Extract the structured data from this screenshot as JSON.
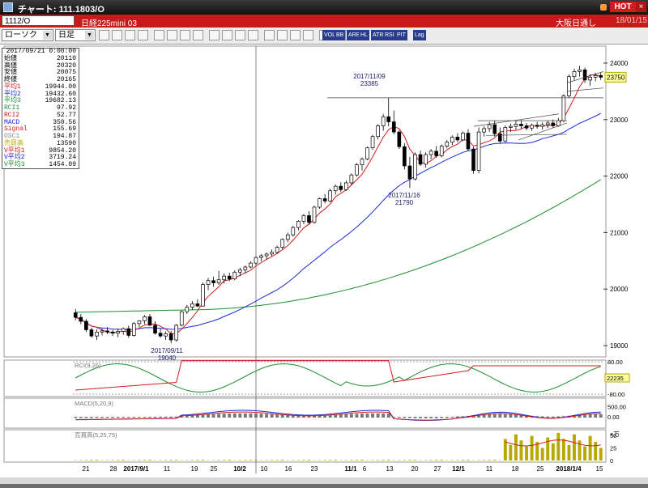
{
  "window": {
    "title": "チャート: 111.1803/O",
    "hot_label": "HOT",
    "close_label": "×"
  },
  "symbol_bar": {
    "code": "1112/O",
    "name": "日経225mini 03",
    "exchange": "大阪日通し",
    "date": "18/01/15"
  },
  "toolbar": {
    "chart_type": "ローソク",
    "period": "日足",
    "text_buttons": [
      "VOL",
      "BB",
      "ARE",
      "HL",
      "ATR",
      "RSI",
      "PIT",
      "Lag"
    ]
  },
  "info_panel": {
    "datetime": "2017/09/21 0:00:00",
    "rows": [
      {
        "k": "始値",
        "v": "20110",
        "c": "#000000"
      },
      {
        "k": "高値",
        "v": "20320",
        "c": "#000000"
      },
      {
        "k": "安値",
        "v": "20075",
        "c": "#000000"
      },
      {
        "k": "終値",
        "v": "20165",
        "c": "#000000"
      },
      {
        "k": "平均1",
        "v": "19944.00",
        "c": "#d21b1b"
      },
      {
        "k": "平均2",
        "v": "19432.60",
        "c": "#1c2bd6"
      },
      {
        "k": "平均3",
        "v": "19682.13",
        "c": "#1b8f2b"
      },
      {
        "k": "RCI1",
        "v": "97.92",
        "c": "#1b8f2b"
      },
      {
        "k": "RCI2",
        "v": "52.77",
        "c": "#d21b1b"
      },
      {
        "k": "MACD",
        "v": "350.56",
        "c": "#1c2bd6"
      },
      {
        "k": "Signal",
        "v": "155.69",
        "c": "#d21b1b"
      },
      {
        "k": "OSC1",
        "v": "194.87",
        "c": "#888888"
      },
      {
        "k": "売買高",
        "v": "13590",
        "c": "#b8a800"
      },
      {
        "k": "V平均1",
        "v": "9854.20",
        "c": "#d21b1b"
      },
      {
        "k": "V平均2",
        "v": "3719.24",
        "c": "#1c2bd6"
      },
      {
        "k": "V平均3",
        "v": "1454.09",
        "c": "#1b8f2b"
      }
    ]
  },
  "price_axis": {
    "ticks": [
      "24000",
      "23000",
      "22000",
      "21000",
      "20000",
      "19000"
    ],
    "current": "23750"
  },
  "annotations": [
    {
      "date": "2017/11/09",
      "value": "23385"
    },
    {
      "date": "2017/11/16",
      "value": "21790"
    },
    {
      "date": "2017/09/11",
      "value": "19040"
    }
  ],
  "rci_panel": {
    "label": "RCI(9,26)",
    "ticks": [
      "80.00",
      "-80.00"
    ],
    "current": "22235"
  },
  "macd_panel": {
    "label": "MACD(5,20,9)",
    "ticks": [
      "500.00",
      "0.00"
    ]
  },
  "volume_panel": {
    "label": "売買高(5,25,75)",
    "ticks": [
      "50",
      "25",
      "0"
    ],
    "unit": "×万"
  },
  "x_axis": {
    "labels": [
      "21",
      "28",
      "2017/9/1",
      "11",
      "19",
      "25",
      "10/2",
      "10",
      "16",
      "23",
      "11/1",
      "6",
      "13",
      "20",
      "27",
      "12/1",
      "11",
      "18",
      "25",
      "2018/1/4",
      "15"
    ]
  },
  "chart_data": {
    "type": "candlestick",
    "y_range": [
      18800,
      24300
    ],
    "candles": [
      {
        "o": 19580,
        "h": 19650,
        "l": 19450,
        "c": 19500
      },
      {
        "o": 19500,
        "h": 19560,
        "l": 19380,
        "c": 19430
      },
      {
        "o": 19430,
        "h": 19470,
        "l": 19240,
        "c": 19280
      },
      {
        "o": 19280,
        "h": 19320,
        "l": 19140,
        "c": 19170
      },
      {
        "o": 19170,
        "h": 19290,
        "l": 19100,
        "c": 19240
      },
      {
        "o": 19240,
        "h": 19300,
        "l": 19180,
        "c": 19260
      },
      {
        "o": 19260,
        "h": 19330,
        "l": 19200,
        "c": 19240
      },
      {
        "o": 19240,
        "h": 19280,
        "l": 19170,
        "c": 19220
      },
      {
        "o": 19220,
        "h": 19300,
        "l": 19150,
        "c": 19250
      },
      {
        "o": 19250,
        "h": 19320,
        "l": 19190,
        "c": 19300
      },
      {
        "o": 19300,
        "h": 19350,
        "l": 19140,
        "c": 19180
      },
      {
        "o": 19180,
        "h": 19420,
        "l": 19160,
        "c": 19390
      },
      {
        "o": 19390,
        "h": 19450,
        "l": 19330,
        "c": 19440
      },
      {
        "o": 19440,
        "h": 19540,
        "l": 19380,
        "c": 19510
      },
      {
        "o": 19510,
        "h": 19560,
        "l": 19350,
        "c": 19360
      },
      {
        "o": 19360,
        "h": 19430,
        "l": 19190,
        "c": 19220
      },
      {
        "o": 19220,
        "h": 19300,
        "l": 19140,
        "c": 19170
      },
      {
        "o": 19170,
        "h": 19250,
        "l": 19100,
        "c": 19210
      },
      {
        "o": 19210,
        "h": 19260,
        "l": 19040,
        "c": 19100
      },
      {
        "o": 19100,
        "h": 19380,
        "l": 19070,
        "c": 19360
      },
      {
        "o": 19360,
        "h": 19620,
        "l": 19340,
        "c": 19600
      },
      {
        "o": 19600,
        "h": 19720,
        "l": 19560,
        "c": 19680
      },
      {
        "o": 19680,
        "h": 19790,
        "l": 19630,
        "c": 19740
      },
      {
        "o": 19740,
        "h": 19820,
        "l": 19680,
        "c": 19700
      },
      {
        "o": 19700,
        "h": 20120,
        "l": 19690,
        "c": 20080
      },
      {
        "o": 20080,
        "h": 20200,
        "l": 19980,
        "c": 20150
      },
      {
        "o": 20150,
        "h": 20220,
        "l": 20040,
        "c": 20110
      },
      {
        "o": 20110,
        "h": 20320,
        "l": 20075,
        "c": 20165
      },
      {
        "o": 20165,
        "h": 20280,
        "l": 20100,
        "c": 20230
      },
      {
        "o": 20230,
        "h": 20290,
        "l": 20140,
        "c": 20180
      },
      {
        "o": 20180,
        "h": 20330,
        "l": 20160,
        "c": 20300
      },
      {
        "o": 20300,
        "h": 20380,
        "l": 20230,
        "c": 20340
      },
      {
        "o": 20340,
        "h": 20420,
        "l": 20280,
        "c": 20390
      },
      {
        "o": 20390,
        "h": 20490,
        "l": 20370,
        "c": 20460
      },
      {
        "o": 20460,
        "h": 20580,
        "l": 20430,
        "c": 20560
      },
      {
        "o": 20560,
        "h": 20620,
        "l": 20490,
        "c": 20590
      },
      {
        "o": 20590,
        "h": 20650,
        "l": 20520,
        "c": 20620
      },
      {
        "o": 20620,
        "h": 20700,
        "l": 20580,
        "c": 20650
      },
      {
        "o": 20650,
        "h": 20770,
        "l": 20620,
        "c": 20740
      },
      {
        "o": 20740,
        "h": 20900,
        "l": 20700,
        "c": 20880
      },
      {
        "o": 20880,
        "h": 21000,
        "l": 20830,
        "c": 20960
      },
      {
        "o": 20960,
        "h": 21120,
        "l": 20930,
        "c": 21090
      },
      {
        "o": 21090,
        "h": 21220,
        "l": 21040,
        "c": 21200
      },
      {
        "o": 21200,
        "h": 21330,
        "l": 21150,
        "c": 21300
      },
      {
        "o": 21300,
        "h": 21380,
        "l": 21140,
        "c": 21180
      },
      {
        "o": 21180,
        "h": 21480,
        "l": 21160,
        "c": 21450
      },
      {
        "o": 21450,
        "h": 21620,
        "l": 21420,
        "c": 21600
      },
      {
        "o": 21600,
        "h": 21680,
        "l": 21520,
        "c": 21560
      },
      {
        "o": 21560,
        "h": 21780,
        "l": 21540,
        "c": 21740
      },
      {
        "o": 21740,
        "h": 21850,
        "l": 21670,
        "c": 21820
      },
      {
        "o": 21820,
        "h": 21890,
        "l": 21720,
        "c": 21760
      },
      {
        "o": 21760,
        "h": 21920,
        "l": 21740,
        "c": 21880
      },
      {
        "o": 21880,
        "h": 22050,
        "l": 21840,
        "c": 22020
      },
      {
        "o": 22020,
        "h": 22230,
        "l": 21990,
        "c": 22200
      },
      {
        "o": 22200,
        "h": 22330,
        "l": 22100,
        "c": 22300
      },
      {
        "o": 22300,
        "h": 22520,
        "l": 22280,
        "c": 22500
      },
      {
        "o": 22500,
        "h": 22730,
        "l": 22460,
        "c": 22700
      },
      {
        "o": 22700,
        "h": 22920,
        "l": 22650,
        "c": 22890
      },
      {
        "o": 22890,
        "h": 23100,
        "l": 22800,
        "c": 23050
      },
      {
        "o": 23050,
        "h": 23385,
        "l": 22880,
        "c": 22960
      },
      {
        "o": 22960,
        "h": 23160,
        "l": 22740,
        "c": 22780
      },
      {
        "o": 22780,
        "h": 22820,
        "l": 22480,
        "c": 22520
      },
      {
        "o": 22520,
        "h": 22580,
        "l": 22120,
        "c": 22180
      },
      {
        "o": 22180,
        "h": 22340,
        "l": 21790,
        "c": 21950
      },
      {
        "o": 21950,
        "h": 22420,
        "l": 21920,
        "c": 22380
      },
      {
        "o": 22380,
        "h": 22450,
        "l": 22180,
        "c": 22210
      },
      {
        "o": 22210,
        "h": 22420,
        "l": 22150,
        "c": 22380
      },
      {
        "o": 22380,
        "h": 22480,
        "l": 22300,
        "c": 22440
      },
      {
        "o": 22440,
        "h": 22530,
        "l": 22320,
        "c": 22360
      },
      {
        "o": 22360,
        "h": 22560,
        "l": 22330,
        "c": 22530
      },
      {
        "o": 22530,
        "h": 22640,
        "l": 22490,
        "c": 22600
      },
      {
        "o": 22600,
        "h": 22720,
        "l": 22550,
        "c": 22690
      },
      {
        "o": 22690,
        "h": 22760,
        "l": 22600,
        "c": 22640
      },
      {
        "o": 22640,
        "h": 22790,
        "l": 22620,
        "c": 22760
      },
      {
        "o": 22760,
        "h": 22830,
        "l": 22450,
        "c": 22480
      },
      {
        "o": 22480,
        "h": 22520,
        "l": 22040,
        "c": 22100
      },
      {
        "o": 22100,
        "h": 22860,
        "l": 22050,
        "c": 22780
      },
      {
        "o": 22780,
        "h": 22880,
        "l": 22700,
        "c": 22840
      },
      {
        "o": 22840,
        "h": 22960,
        "l": 22780,
        "c": 22910
      },
      {
        "o": 22910,
        "h": 22980,
        "l": 22700,
        "c": 22750
      },
      {
        "o": 22750,
        "h": 22860,
        "l": 22580,
        "c": 22620
      },
      {
        "o": 22620,
        "h": 22900,
        "l": 22600,
        "c": 22860
      },
      {
        "o": 22860,
        "h": 22930,
        "l": 22780,
        "c": 22880
      },
      {
        "o": 22880,
        "h": 22990,
        "l": 22820,
        "c": 22920
      },
      {
        "o": 22920,
        "h": 23000,
        "l": 22840,
        "c": 22890
      },
      {
        "o": 22890,
        "h": 22940,
        "l": 22810,
        "c": 22850
      },
      {
        "o": 22850,
        "h": 22930,
        "l": 22800,
        "c": 22900
      },
      {
        "o": 22900,
        "h": 22960,
        "l": 22840,
        "c": 22880
      },
      {
        "o": 22880,
        "h": 22950,
        "l": 22820,
        "c": 22910
      },
      {
        "o": 22910,
        "h": 22980,
        "l": 22850,
        "c": 22940
      },
      {
        "o": 22940,
        "h": 23000,
        "l": 22860,
        "c": 22890
      },
      {
        "o": 22890,
        "h": 23030,
        "l": 22870,
        "c": 22980
      },
      {
        "o": 22980,
        "h": 23450,
        "l": 22950,
        "c": 23420
      },
      {
        "o": 23420,
        "h": 23800,
        "l": 23380,
        "c": 23760
      },
      {
        "o": 23760,
        "h": 23900,
        "l": 23700,
        "c": 23850
      },
      {
        "o": 23850,
        "h": 23950,
        "l": 23760,
        "c": 23880
      },
      {
        "o": 23880,
        "h": 23920,
        "l": 23650,
        "c": 23700
      },
      {
        "o": 23700,
        "h": 23800,
        "l": 23600,
        "c": 23750
      },
      {
        "o": 23750,
        "h": 23830,
        "l": 23680,
        "c": 23780
      },
      {
        "o": 23780,
        "h": 23840,
        "l": 23700,
        "c": 23750
      }
    ]
  }
}
